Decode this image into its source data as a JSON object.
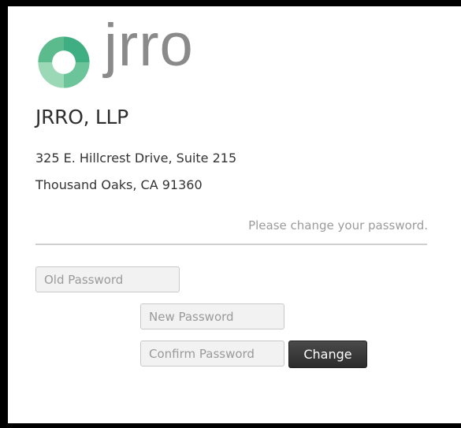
{
  "brand": {
    "logo_text": "jrro",
    "company_name": "JRRO, LLP",
    "logo_colors": [
      "#3fae82",
      "#6cc49a",
      "#9ad8b6",
      "#c4ead3"
    ]
  },
  "address": {
    "line1": "325 E. Hillcrest Drive, Suite 215",
    "line2": "Thousand Oaks, CA 91360"
  },
  "form": {
    "prompt": "Please change your password.",
    "old_password_placeholder": "Old Password",
    "new_password_placeholder": "New Password",
    "confirm_password_placeholder": "Confirm Password",
    "submit_label": "Change"
  }
}
